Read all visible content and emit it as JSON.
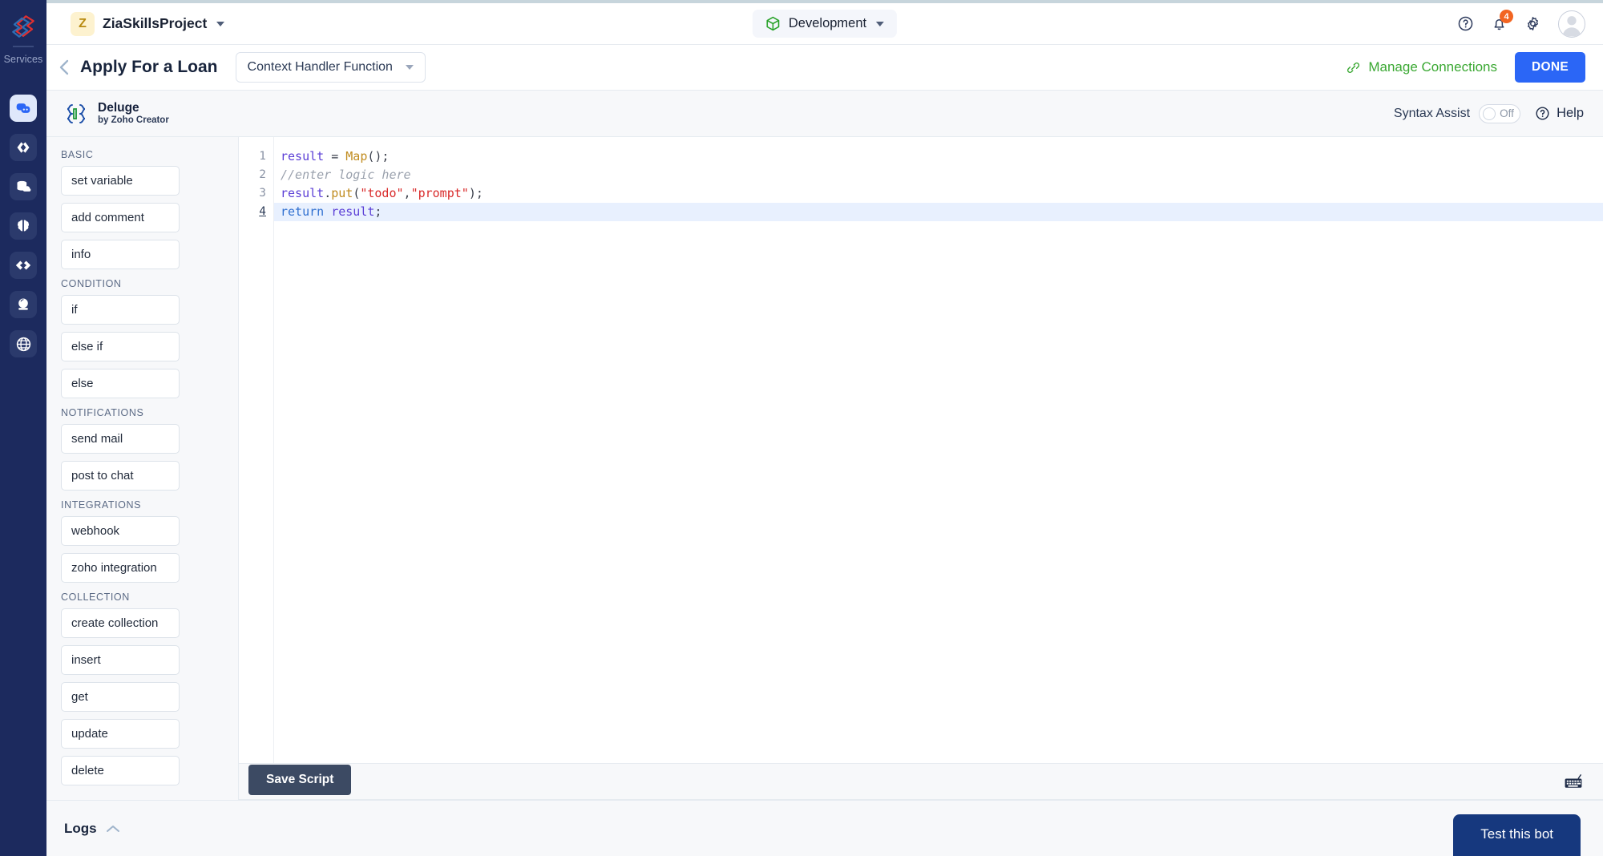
{
  "colors": {
    "rail_bg": "#1c2a5e",
    "accent_blue": "#2b66f6",
    "accent_green": "#3aa832",
    "badge_orange": "#f26522",
    "dark_navy_button": "#16387e",
    "save_button": "#3c4a63"
  },
  "rail": {
    "logo_name": "zoho-logo",
    "services_label": "Services",
    "items": [
      {
        "icon": "chat-bubbles-icon",
        "name": "sidebar-item-chat",
        "active": true
      },
      {
        "icon": "code-brackets-icon",
        "name": "sidebar-item-code",
        "active": false
      },
      {
        "icon": "database-cloud-icon",
        "name": "sidebar-item-data",
        "active": false
      },
      {
        "icon": "brain-icon",
        "name": "sidebar-item-ai",
        "active": false
      },
      {
        "icon": "infinity-loop-icon",
        "name": "sidebar-item-flow",
        "active": false
      },
      {
        "icon": "crystal-ball-icon",
        "name": "sidebar-item-prediction",
        "active": false
      },
      {
        "icon": "globe-icon",
        "name": "sidebar-item-web",
        "active": false
      }
    ]
  },
  "topbar": {
    "project_initial": "Z",
    "project_name": "ZiaSkillsProject",
    "environment": "Development",
    "environment_icon": "cube-icon",
    "help_icon": "help-circle-icon",
    "notifications_icon": "bell-icon",
    "notifications_count": "4",
    "settings_icon": "gear-icon",
    "avatar_icon": "avatar"
  },
  "subheader": {
    "back_icon": "chevron-left-icon",
    "title": "Apply For a Loan",
    "function_select_value": "Context Handler Function",
    "manage_connections_label": "Manage Connections",
    "manage_connections_icon": "link-icon",
    "done_label": "DONE"
  },
  "deluge": {
    "title": "Deluge",
    "subtitle": "by Zoho Creator",
    "logo_icon": "deluge-brackets-icon",
    "syntax_assist_label": "Syntax Assist",
    "syntax_assist_state": "Off",
    "help_label": "Help",
    "help_icon": "help-circle-icon"
  },
  "palette": {
    "groups": [
      {
        "label": "BASIC",
        "items": [
          "set variable",
          "add comment",
          "info"
        ]
      },
      {
        "label": "CONDITION",
        "items": [
          "if",
          "else if",
          "else"
        ]
      },
      {
        "label": "NOTIFICATIONS",
        "items": [
          "send mail",
          "post to chat"
        ]
      },
      {
        "label": "INTEGRATIONS",
        "items": [
          "webhook",
          "zoho integration"
        ]
      },
      {
        "label": "COLLECTION",
        "items": [
          "create collection",
          "insert",
          "get",
          "update",
          "delete"
        ]
      }
    ]
  },
  "editor": {
    "line_numbers": [
      "1",
      "2",
      "3",
      "4"
    ],
    "active_line": 4,
    "lines": [
      {
        "n": "1",
        "tokens": [
          {
            "t": "result",
            "c": "tk-var"
          },
          {
            "t": " = ",
            "c": "tk-op"
          },
          {
            "t": "Map",
            "c": "tk-fn"
          },
          {
            "t": "();",
            "c": "tk-punct"
          }
        ]
      },
      {
        "n": "2",
        "tokens": [
          {
            "t": "//enter logic here",
            "c": "tk-com"
          }
        ]
      },
      {
        "n": "3",
        "tokens": [
          {
            "t": "result",
            "c": "tk-var"
          },
          {
            "t": ".",
            "c": "tk-punct"
          },
          {
            "t": "put",
            "c": "tk-fn"
          },
          {
            "t": "(",
            "c": "tk-punct"
          },
          {
            "t": "\"todo\"",
            "c": "tk-str"
          },
          {
            "t": ",",
            "c": "tk-punct"
          },
          {
            "t": "\"prompt\"",
            "c": "tk-str"
          },
          {
            "t": ");",
            "c": "tk-punct"
          }
        ]
      },
      {
        "n": "4",
        "tokens": [
          {
            "t": "return",
            "c": "tk-kw"
          },
          {
            "t": " ",
            "c": "tk-op"
          },
          {
            "t": "result",
            "c": "tk-var"
          },
          {
            "t": ";",
            "c": "tk-punct"
          }
        ]
      }
    ],
    "plain_text": "result = Map();\n//enter logic here\nresult.put(\"todo\",\"prompt\");\nreturn result;"
  },
  "actionstrip": {
    "save_label": "Save Script",
    "keyboard_icon": "keyboard-icon"
  },
  "logs": {
    "label": "Logs",
    "collapse_icon": "chevron-up-icon",
    "test_bot_label": "Test this bot"
  }
}
